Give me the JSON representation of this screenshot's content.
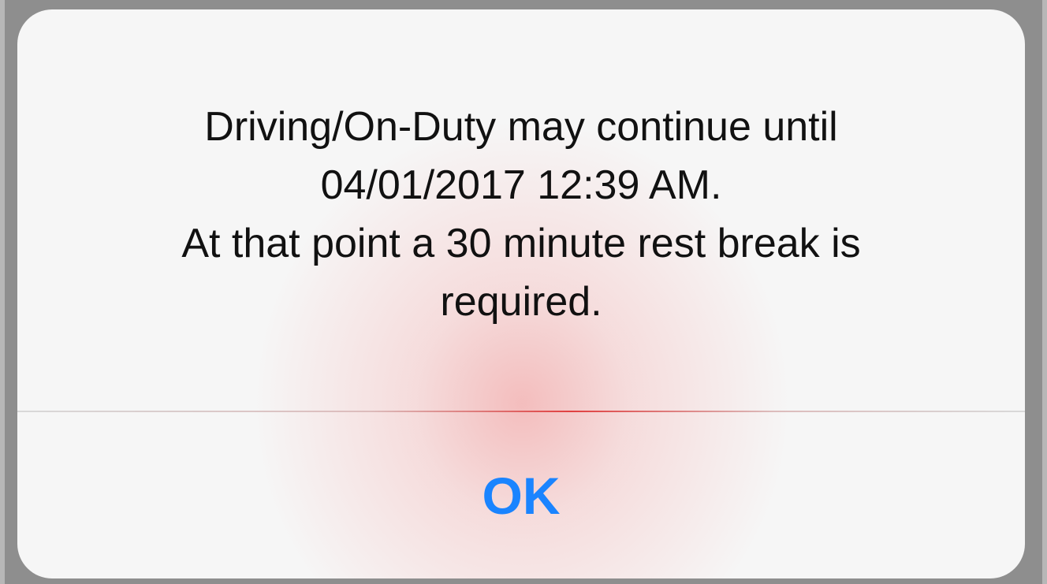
{
  "alert": {
    "message_lines": [
      "Driving/On-Duty may continue until",
      "04/01/2017 12:39 AM.",
      "At that point a 30 minute rest break is",
      "required."
    ],
    "ok_label": "OK",
    "ok_color": "#1A84FF"
  }
}
